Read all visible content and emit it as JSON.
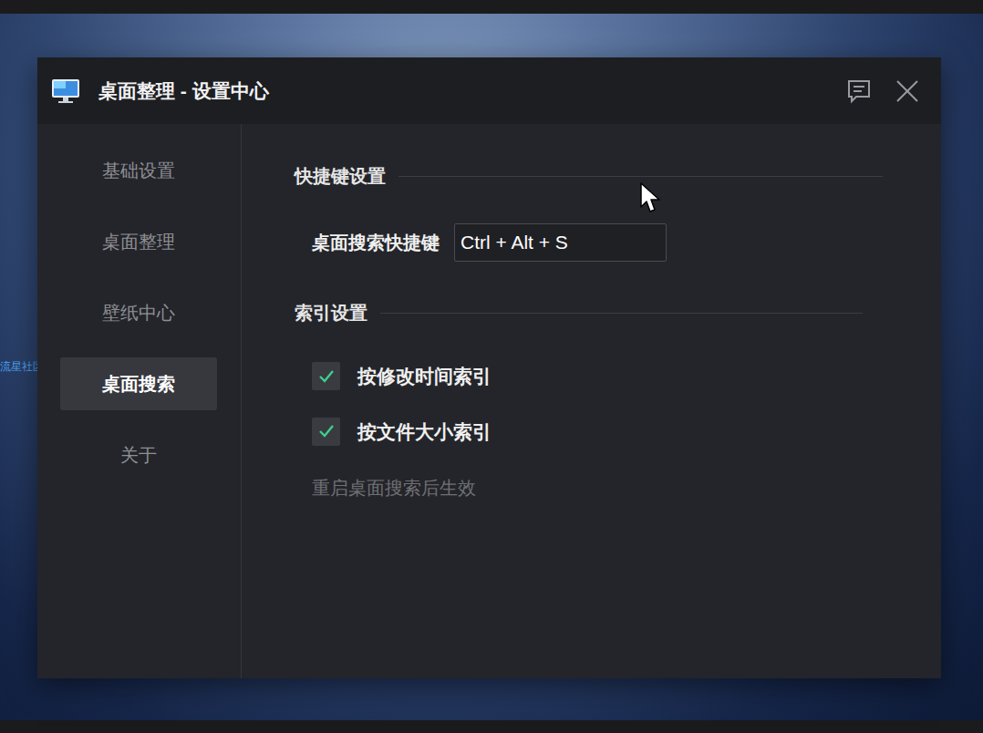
{
  "window": {
    "title": "桌面整理 - 设置中心"
  },
  "desktop": {
    "watermark": "流星社区"
  },
  "sidebar": {
    "items": [
      {
        "label": "基础设置",
        "selected": false
      },
      {
        "label": "桌面整理",
        "selected": false
      },
      {
        "label": "壁纸中心",
        "selected": false
      },
      {
        "label": "桌面搜索",
        "selected": true
      },
      {
        "label": "关于",
        "selected": false
      }
    ]
  },
  "hotkey_section": {
    "title": "快捷键设置",
    "label": "桌面搜索快捷键",
    "value": "Ctrl + Alt + S"
  },
  "index_section": {
    "title": "索引设置",
    "options": [
      {
        "label": "按修改时间索引",
        "checked": true
      },
      {
        "label": "按文件大小索引",
        "checked": true
      }
    ],
    "note": "重启桌面搜索后生效"
  }
}
